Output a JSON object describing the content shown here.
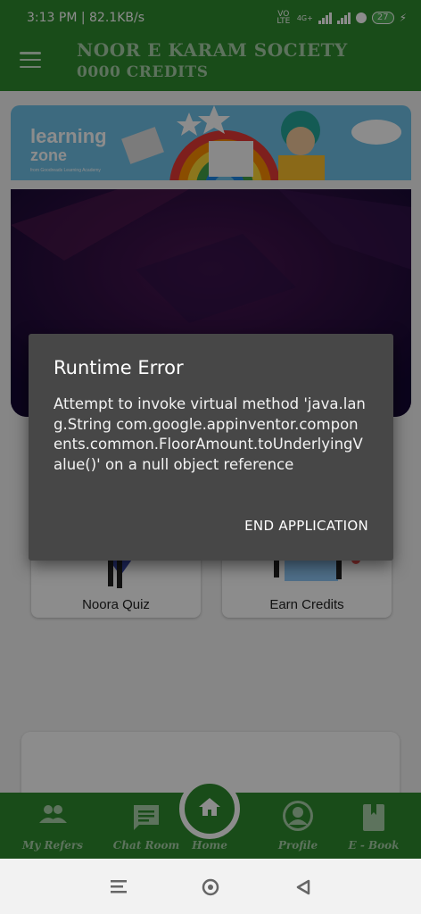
{
  "status_bar": {
    "time_speed": "3:13 PM | 82.1KB/s",
    "volte": "VO LTE",
    "network": "4G+",
    "battery": "27"
  },
  "app_bar": {
    "title": "NOOR E KARAM SOCIETY",
    "credits": "0000 CREDITS"
  },
  "banner": {
    "brand_line1": "learning",
    "brand_line2": "zone",
    "brand_tagline": "from Goodreads Learning Academy"
  },
  "cards": [
    {
      "label": "Noora Quiz"
    },
    {
      "label": "Earn Credits"
    }
  ],
  "bottom_nav": {
    "items": [
      {
        "label": "My Refers",
        "icon": "people-icon"
      },
      {
        "label": "Chat Room",
        "icon": "chat-icon"
      },
      {
        "label": "Home",
        "icon": "home-icon"
      },
      {
        "label": "Profile",
        "icon": "profile-icon"
      },
      {
        "label": "E - Book",
        "icon": "book-icon"
      }
    ]
  },
  "dialog": {
    "title": "Runtime Error",
    "message": "Attempt to invoke virtual method 'java.lang.String com.google.appinventor.components.common.FloorAmount.toUnderlyingValue()' on a null object reference",
    "button": "END APPLICATION"
  },
  "colors": {
    "primary_green": "#2f8a2f",
    "dialog_bg": "#474747"
  }
}
